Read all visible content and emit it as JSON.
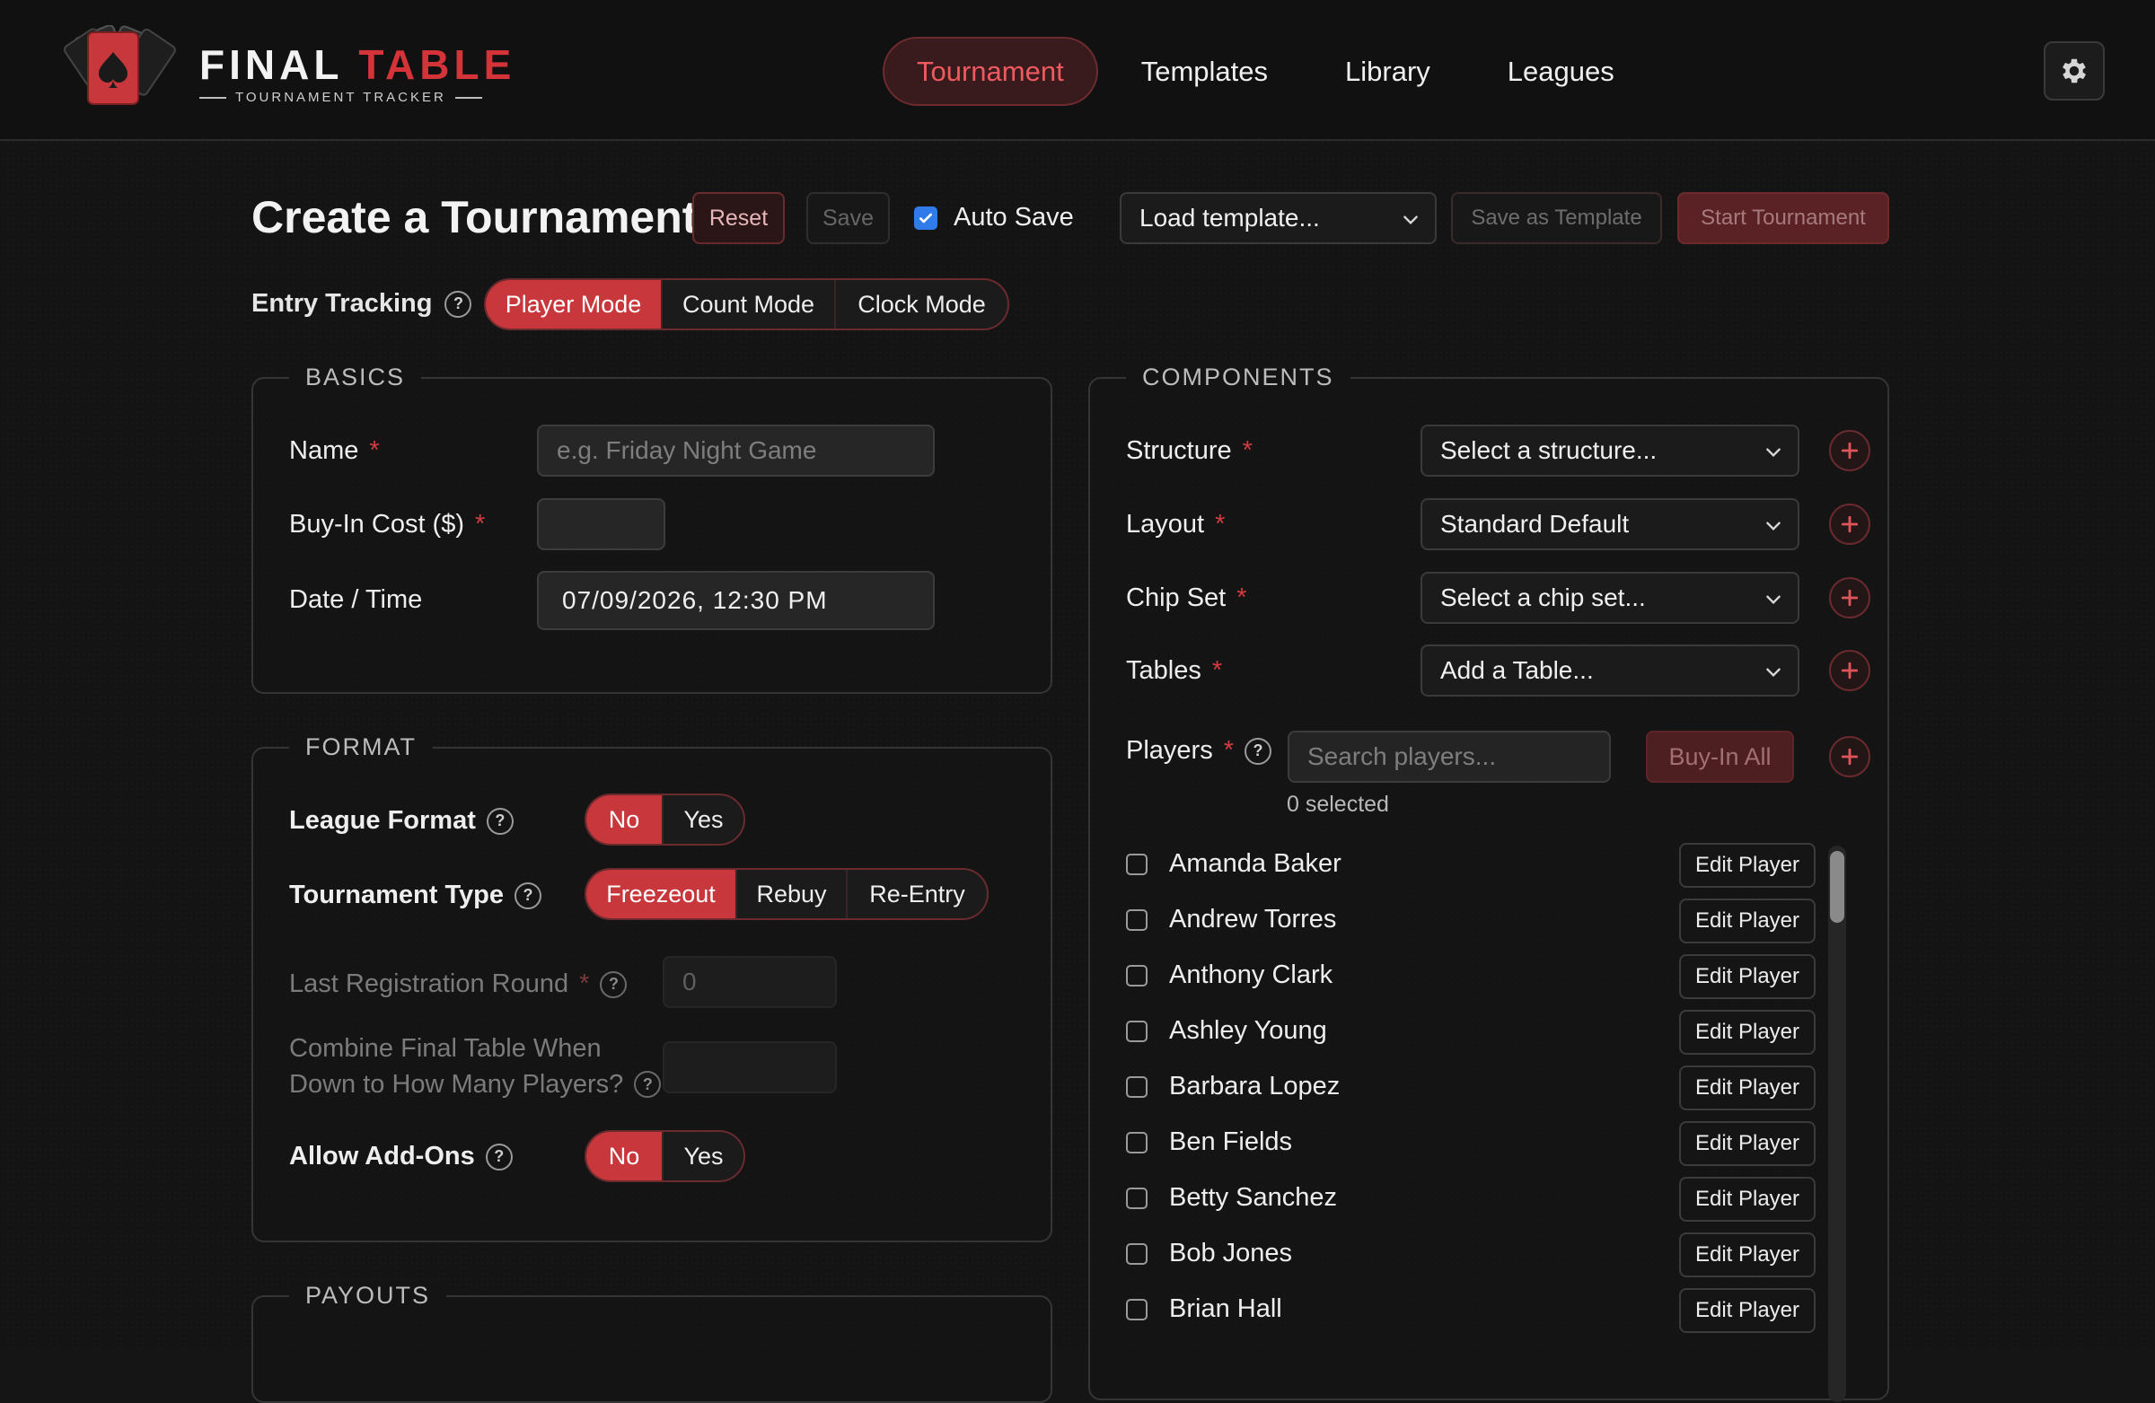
{
  "app": {
    "logo_title_a": "FINAL ",
    "logo_title_b": "TABLE",
    "logo_subtitle": "TOURNAMENT TRACKER"
  },
  "nav": {
    "items": [
      {
        "label": "Tournament",
        "active": true
      },
      {
        "label": "Templates",
        "active": false
      },
      {
        "label": "Library",
        "active": false
      },
      {
        "label": "Leagues",
        "active": false
      }
    ]
  },
  "header": {
    "title": "Create a Tournament",
    "reset_label": "Reset",
    "save_label": "Save",
    "autosave_label": "Auto Save",
    "autosave_checked": true,
    "template_select": "Load template...",
    "save_template_label": "Save as Template",
    "start_label": "Start Tournament"
  },
  "entry_tracking": {
    "label": "Entry Tracking",
    "options": [
      "Player Mode",
      "Count Mode",
      "Clock Mode"
    ],
    "selected": "Player Mode"
  },
  "basics": {
    "legend": "BASICS",
    "name_label": "Name",
    "name_placeholder": "e.g. Friday Night Game",
    "buyin_label": "Buy-In Cost ($)",
    "buyin_value": "",
    "datetime_label": "Date / Time",
    "datetime_value": "07/09/2026, 12:30 PM",
    "required_mark": "*"
  },
  "format": {
    "legend": "FORMAT",
    "league_label": "League Format",
    "league_options": [
      "No",
      "Yes"
    ],
    "league_selected": "No",
    "type_label": "Tournament Type",
    "type_options": [
      "Freezeout",
      "Rebuy",
      "Re-Entry"
    ],
    "type_selected": "Freezeout",
    "last_reg_label": "Last Registration Round",
    "last_reg_value": "0",
    "combine_label_1": "Combine Final Table When",
    "combine_label_2": "Down to How Many Players?",
    "combine_value": "",
    "addons_label": "Allow Add-Ons",
    "addons_options": [
      "No",
      "Yes"
    ],
    "addons_selected": "No"
  },
  "payouts": {
    "legend": "PAYOUTS"
  },
  "components": {
    "legend": "COMPONENTS",
    "structure_label": "Structure",
    "structure_value": "Select a structure...",
    "layout_label": "Layout",
    "layout_value": "Standard Default",
    "chipset_label": "Chip Set",
    "chipset_value": "Select a chip set...",
    "tables_label": "Tables",
    "tables_value": "Add a Table...",
    "players_label": "Players",
    "players_search_placeholder": "Search players...",
    "buyin_all_label": "Buy-In All",
    "selected_count": "0 selected",
    "edit_label": "Edit Player",
    "players": [
      "Amanda Baker",
      "Andrew Torres",
      "Anthony Clark",
      "Ashley Young",
      "Barbara Lopez",
      "Ben Fields",
      "Betty Sanchez",
      "Bob Jones",
      "Brian Hall"
    ]
  },
  "colors": {
    "accent": "#c8373b",
    "accent_dark": "#6b2a2e",
    "background": "#141414",
    "checkbox_blue": "#2f7be9"
  }
}
